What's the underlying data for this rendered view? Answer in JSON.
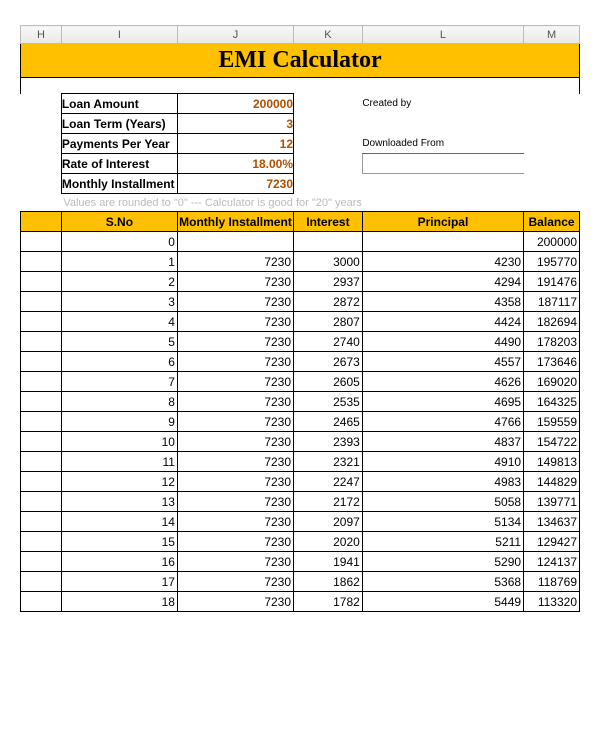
{
  "columns": [
    "H",
    "I",
    "J",
    "K",
    "L",
    "M"
  ],
  "title": "EMI Calculator",
  "params": {
    "loan_amount_label": "Loan Amount",
    "loan_amount_value": "200000",
    "loan_term_label": "Loan Term (Years)",
    "loan_term_value": "3",
    "payments_per_year_label": "Payments Per Year",
    "payments_per_year_value": "12",
    "rate_label": "Rate of Interest",
    "rate_value": "18.00%",
    "monthly_label": "Monthly Installment",
    "monthly_value": "7230"
  },
  "side": {
    "created_by": "Created by",
    "downloaded_from": "Downloaded From"
  },
  "note": "Values are rounded to \"0\"  ---  Calculator is good for \"20\" years",
  "headers": {
    "sno": "S.No",
    "inst": "Monthly Installment",
    "interest": "Interest",
    "principal": "Principal",
    "balance": "Balance"
  },
  "rows": [
    {
      "sno": "0",
      "inst": "",
      "interest": "",
      "principal": "",
      "balance": "200000"
    },
    {
      "sno": "1",
      "inst": "7230",
      "interest": "3000",
      "principal": "4230",
      "balance": "195770"
    },
    {
      "sno": "2",
      "inst": "7230",
      "interest": "2937",
      "principal": "4294",
      "balance": "191476"
    },
    {
      "sno": "3",
      "inst": "7230",
      "interest": "2872",
      "principal": "4358",
      "balance": "187117"
    },
    {
      "sno": "4",
      "inst": "7230",
      "interest": "2807",
      "principal": "4424",
      "balance": "182694"
    },
    {
      "sno": "5",
      "inst": "7230",
      "interest": "2740",
      "principal": "4490",
      "balance": "178203"
    },
    {
      "sno": "6",
      "inst": "7230",
      "interest": "2673",
      "principal": "4557",
      "balance": "173646"
    },
    {
      "sno": "7",
      "inst": "7230",
      "interest": "2605",
      "principal": "4626",
      "balance": "169020"
    },
    {
      "sno": "8",
      "inst": "7230",
      "interest": "2535",
      "principal": "4695",
      "balance": "164325"
    },
    {
      "sno": "9",
      "inst": "7230",
      "interest": "2465",
      "principal": "4766",
      "balance": "159559"
    },
    {
      "sno": "10",
      "inst": "7230",
      "interest": "2393",
      "principal": "4837",
      "balance": "154722"
    },
    {
      "sno": "11",
      "inst": "7230",
      "interest": "2321",
      "principal": "4910",
      "balance": "149813"
    },
    {
      "sno": "12",
      "inst": "7230",
      "interest": "2247",
      "principal": "4983",
      "balance": "144829"
    },
    {
      "sno": "13",
      "inst": "7230",
      "interest": "2172",
      "principal": "5058",
      "balance": "139771"
    },
    {
      "sno": "14",
      "inst": "7230",
      "interest": "2097",
      "principal": "5134",
      "balance": "134637"
    },
    {
      "sno": "15",
      "inst": "7230",
      "interest": "2020",
      "principal": "5211",
      "balance": "129427"
    },
    {
      "sno": "16",
      "inst": "7230",
      "interest": "1941",
      "principal": "5290",
      "balance": "124137"
    },
    {
      "sno": "17",
      "inst": "7230",
      "interest": "1862",
      "principal": "5368",
      "balance": "118769"
    },
    {
      "sno": "18",
      "inst": "7230",
      "interest": "1782",
      "principal": "5449",
      "balance": "113320"
    }
  ]
}
